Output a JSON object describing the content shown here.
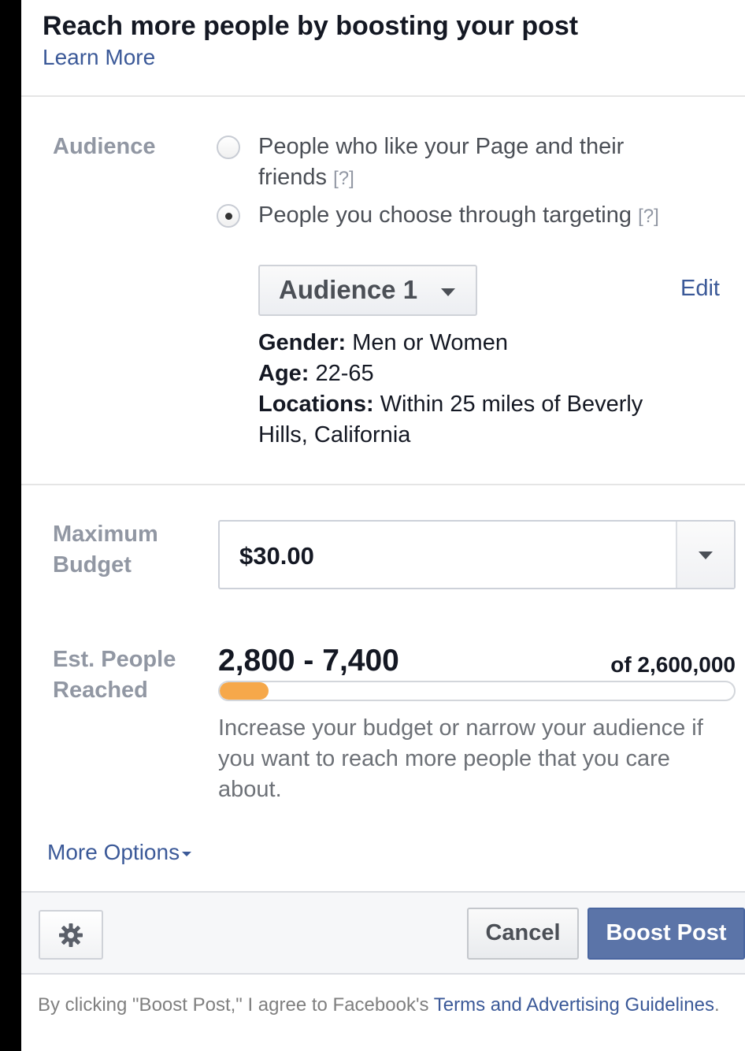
{
  "header": {
    "title": "Reach more people by boosting your post",
    "learn_more": "Learn More"
  },
  "audience": {
    "label": "Audience",
    "options": [
      {
        "line1": "People who like your Page and their",
        "line2": "friends",
        "help": "[?]",
        "selected": false
      },
      {
        "line1": "People you choose through targeting",
        "help": "[?]",
        "selected": true
      }
    ],
    "dropdown_label": "Audience 1",
    "edit_label": "Edit",
    "details": {
      "gender_key": "Gender:",
      "gender_val": "Men or Women",
      "age_key": "Age:",
      "age_val": "22-65",
      "locations_key": "Locations:",
      "locations_val_line1": "Within 25 miles of Beverly",
      "locations_val_line2": "Hills, California"
    }
  },
  "budget": {
    "label_line1": "Maximum",
    "label_line2": "Budget",
    "value": "$30.00"
  },
  "reach": {
    "label_line1": "Est. People",
    "label_line2": "Reached",
    "range": "2,800 - 7,400",
    "total": "of 2,600,000",
    "fill_fraction": 0.095,
    "note": "Increase your budget or narrow your audience if you want to reach more people that you care about."
  },
  "more_options": "More Options",
  "footer": {
    "cancel_label": "Cancel",
    "boost_label": "Boost Post"
  },
  "legal": {
    "prefix": "By clicking \"Boost Post,\" I agree to Facebook's ",
    "link": "Terms and Advertising Guidelines",
    "suffix": "."
  },
  "colors": {
    "link": "#3b5998",
    "progress": "#f6a84a",
    "primary_button": "#5b74a8"
  },
  "icons": {
    "gear": "gear-icon",
    "caret": "chevron-down-icon"
  }
}
